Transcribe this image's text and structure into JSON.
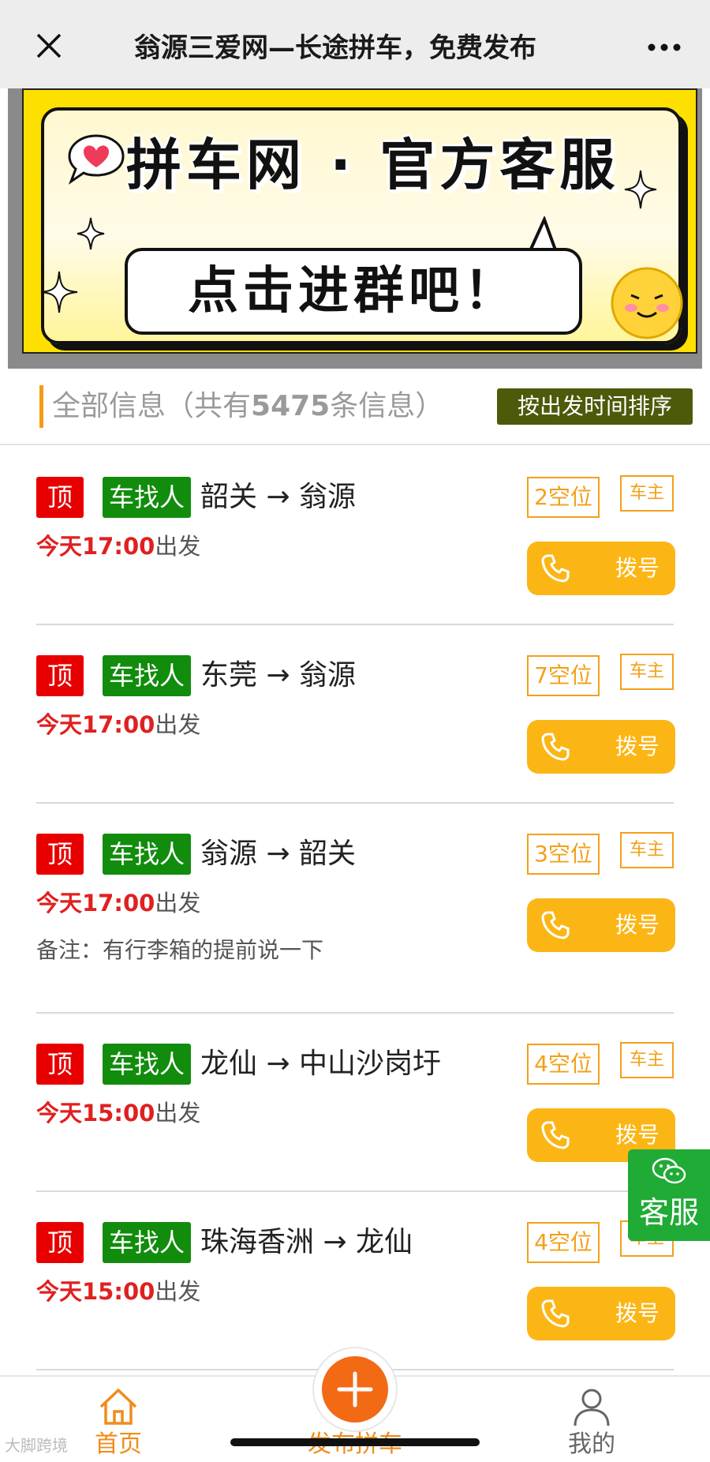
{
  "header": {
    "title": "翁源三爱网—长途拼车，免费发布"
  },
  "banner": {
    "headline": "拼车网 · 官方客服",
    "cta": "点击进群吧！"
  },
  "section": {
    "label_prefix": "全部信息（共有",
    "count": "5475",
    "label_suffix": "条信息）",
    "sort_button": "按出发时间排序"
  },
  "listings": [
    {
      "top": "顶",
      "type": "车找人",
      "route": "韶关 → 翁源",
      "time_day": "今天17:00",
      "time_suffix": "出发",
      "note": "",
      "seats": "2空位",
      "owner": "车主",
      "dial": "拨号"
    },
    {
      "top": "顶",
      "type": "车找人",
      "route": "东莞 → 翁源",
      "time_day": "今天17:00",
      "time_suffix": "出发",
      "note": "",
      "seats": "7空位",
      "owner": "车主",
      "dial": "拨号"
    },
    {
      "top": "顶",
      "type": "车找人",
      "route": "翁源 → 韶关",
      "time_day": "今天17:00",
      "time_suffix": "出发",
      "note": "备注：有行李箱的提前说一下",
      "seats": "3空位",
      "owner": "车主",
      "dial": "拨号"
    },
    {
      "top": "顶",
      "type": "车找人",
      "route": "龙仙 → 中山沙岗圩",
      "time_day": "今天15:00",
      "time_suffix": "出发",
      "note": "",
      "seats": "4空位",
      "owner": "车主",
      "dial": "拨号"
    },
    {
      "top": "顶",
      "type": "车找人",
      "route": "珠海香洲 → 龙仙",
      "time_day": "今天15:00",
      "time_suffix": "出发",
      "note": "",
      "seats": "4空位",
      "owner": "车主",
      "dial": "拨号"
    }
  ],
  "float_service": {
    "label": "客服",
    "icon": "wechat-icon"
  },
  "bottom_nav": {
    "home": "首页",
    "publish": "发布拼车",
    "mine": "我的"
  },
  "watermark": "大脚跨境",
  "colors": {
    "accent_orange": "#f39c12",
    "dial_yellow": "#fbb616",
    "top_red": "#e80000",
    "type_green": "#118c0c",
    "sort_olive": "#4d5a0a",
    "service_green": "#20aa36",
    "publish_orange": "#f26a14"
  }
}
